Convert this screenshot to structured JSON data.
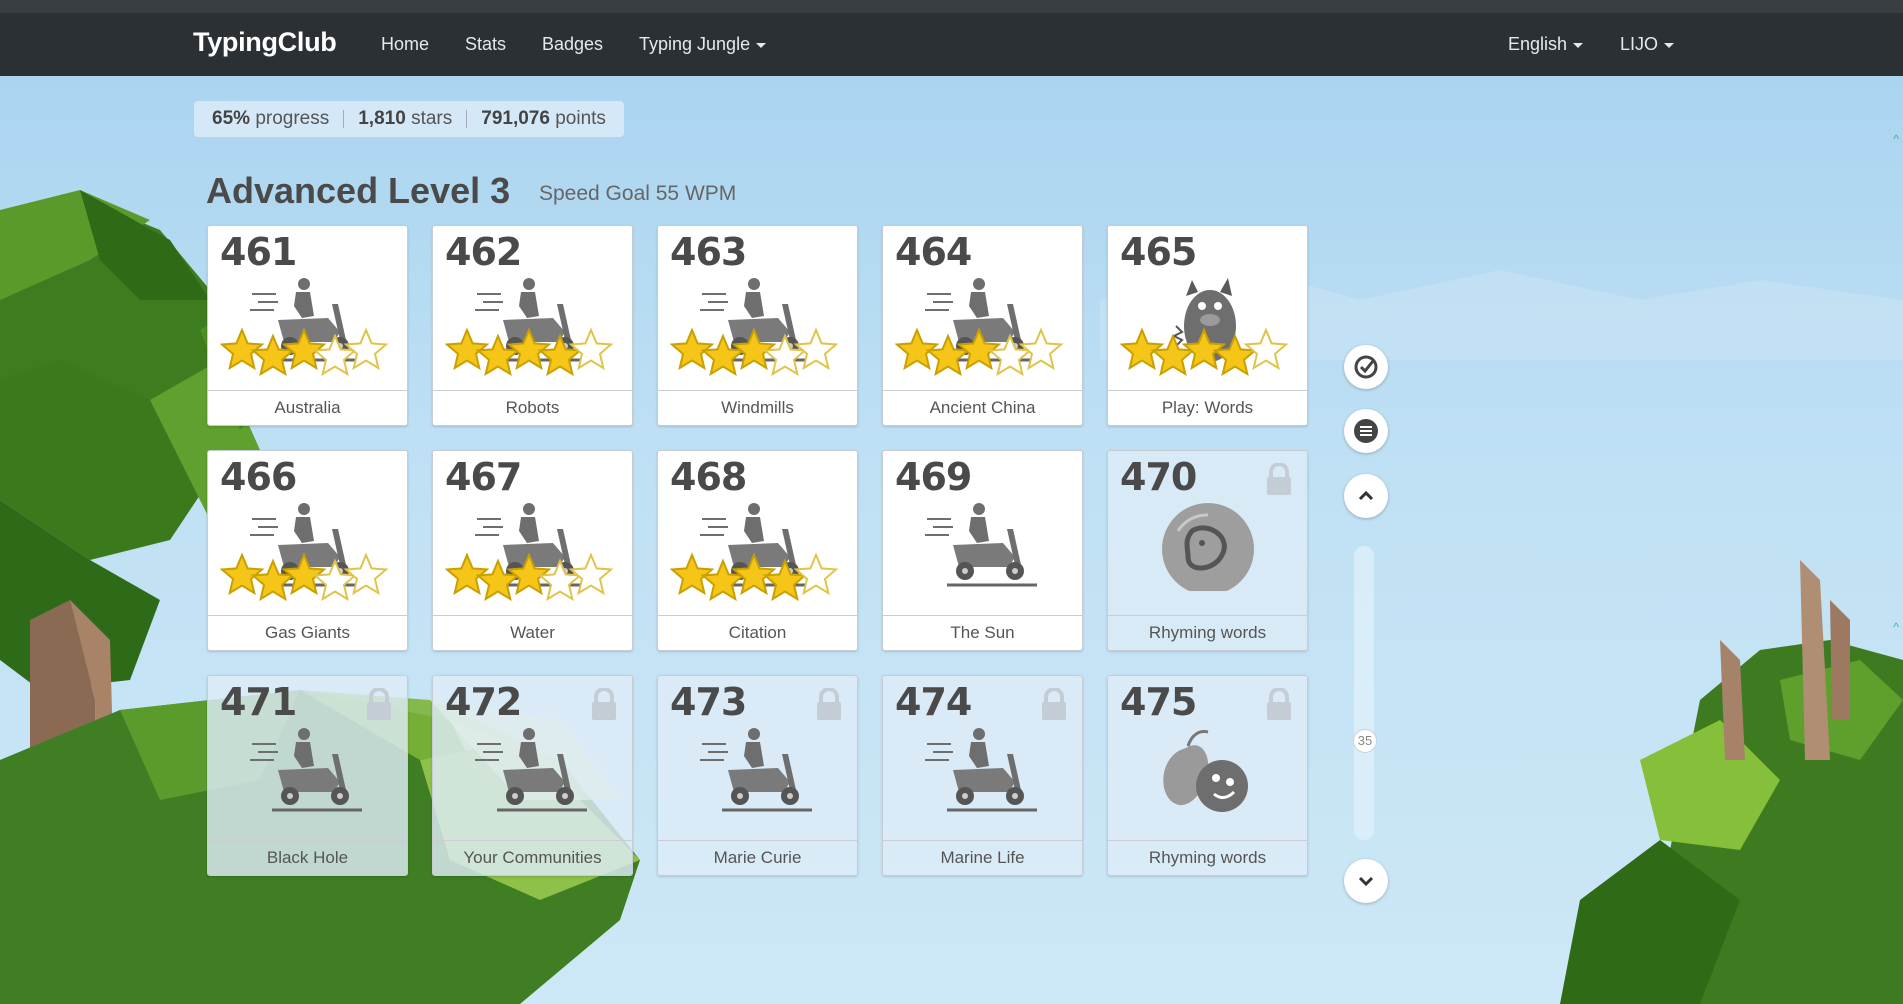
{
  "nav": {
    "brand": "TypingClub",
    "home": "Home",
    "stats": "Stats",
    "badges": "Badges",
    "jungle": "Typing Jungle",
    "language": "English",
    "user": "LIJO"
  },
  "stats": {
    "progress_value": "65%",
    "progress_label": "progress",
    "stars_value": "1,810",
    "stars_label": "stars",
    "points_value": "791,076",
    "points_label": "points"
  },
  "level": {
    "title": "Advanced Level 3",
    "subtitle": "Speed Goal 55 WPM"
  },
  "lessons": [
    {
      "num": "461",
      "label": "Australia",
      "stars": 3,
      "icon": "scooter-icon",
      "locked": false
    },
    {
      "num": "462",
      "label": "Robots",
      "stars": 4,
      "icon": "scooter-icon",
      "locked": false
    },
    {
      "num": "463",
      "label": "Windmills",
      "stars": 3,
      "icon": "scooter-icon",
      "locked": false
    },
    {
      "num": "464",
      "label": "Ancient China",
      "stars": 3,
      "icon": "scooter-icon",
      "locked": false
    },
    {
      "num": "465",
      "label": "Play: Words",
      "stars": 4,
      "icon": "monster-icon",
      "locked": false
    },
    {
      "num": "466",
      "label": "Gas Giants",
      "stars": 3,
      "icon": "scooter-icon",
      "locked": false
    },
    {
      "num": "467",
      "label": "Water",
      "stars": 3,
      "icon": "scooter-icon",
      "locked": false
    },
    {
      "num": "468",
      "label": "Citation",
      "stars": 4,
      "icon": "scooter-icon",
      "locked": false
    },
    {
      "num": "469",
      "label": "The Sun",
      "stars": 0,
      "icon": "scooter-icon",
      "locked": false
    },
    {
      "num": "470",
      "label": "Rhyming words",
      "stars": 0,
      "icon": "game-badge-icon",
      "locked": true
    },
    {
      "num": "471",
      "label": "Black Hole",
      "stars": 0,
      "icon": "scooter-icon",
      "locked": true
    },
    {
      "num": "472",
      "label": "Your Communities",
      "stars": 0,
      "icon": "scooter-icon",
      "locked": true
    },
    {
      "num": "473",
      "label": "Marie Curie",
      "stars": 0,
      "icon": "scooter-icon",
      "locked": true
    },
    {
      "num": "474",
      "label": "Marine Life",
      "stars": 0,
      "icon": "scooter-icon",
      "locked": true
    },
    {
      "num": "475",
      "label": "Rhyming words",
      "stars": 0,
      "icon": "apple-game-icon",
      "locked": true
    }
  ],
  "sidebar": {
    "slider_value": "35"
  },
  "colors": {
    "navbar": "#2b3035",
    "sky": "#a6d2ef",
    "star": "#f5c518",
    "icon_gray": "#6e6e6e"
  }
}
